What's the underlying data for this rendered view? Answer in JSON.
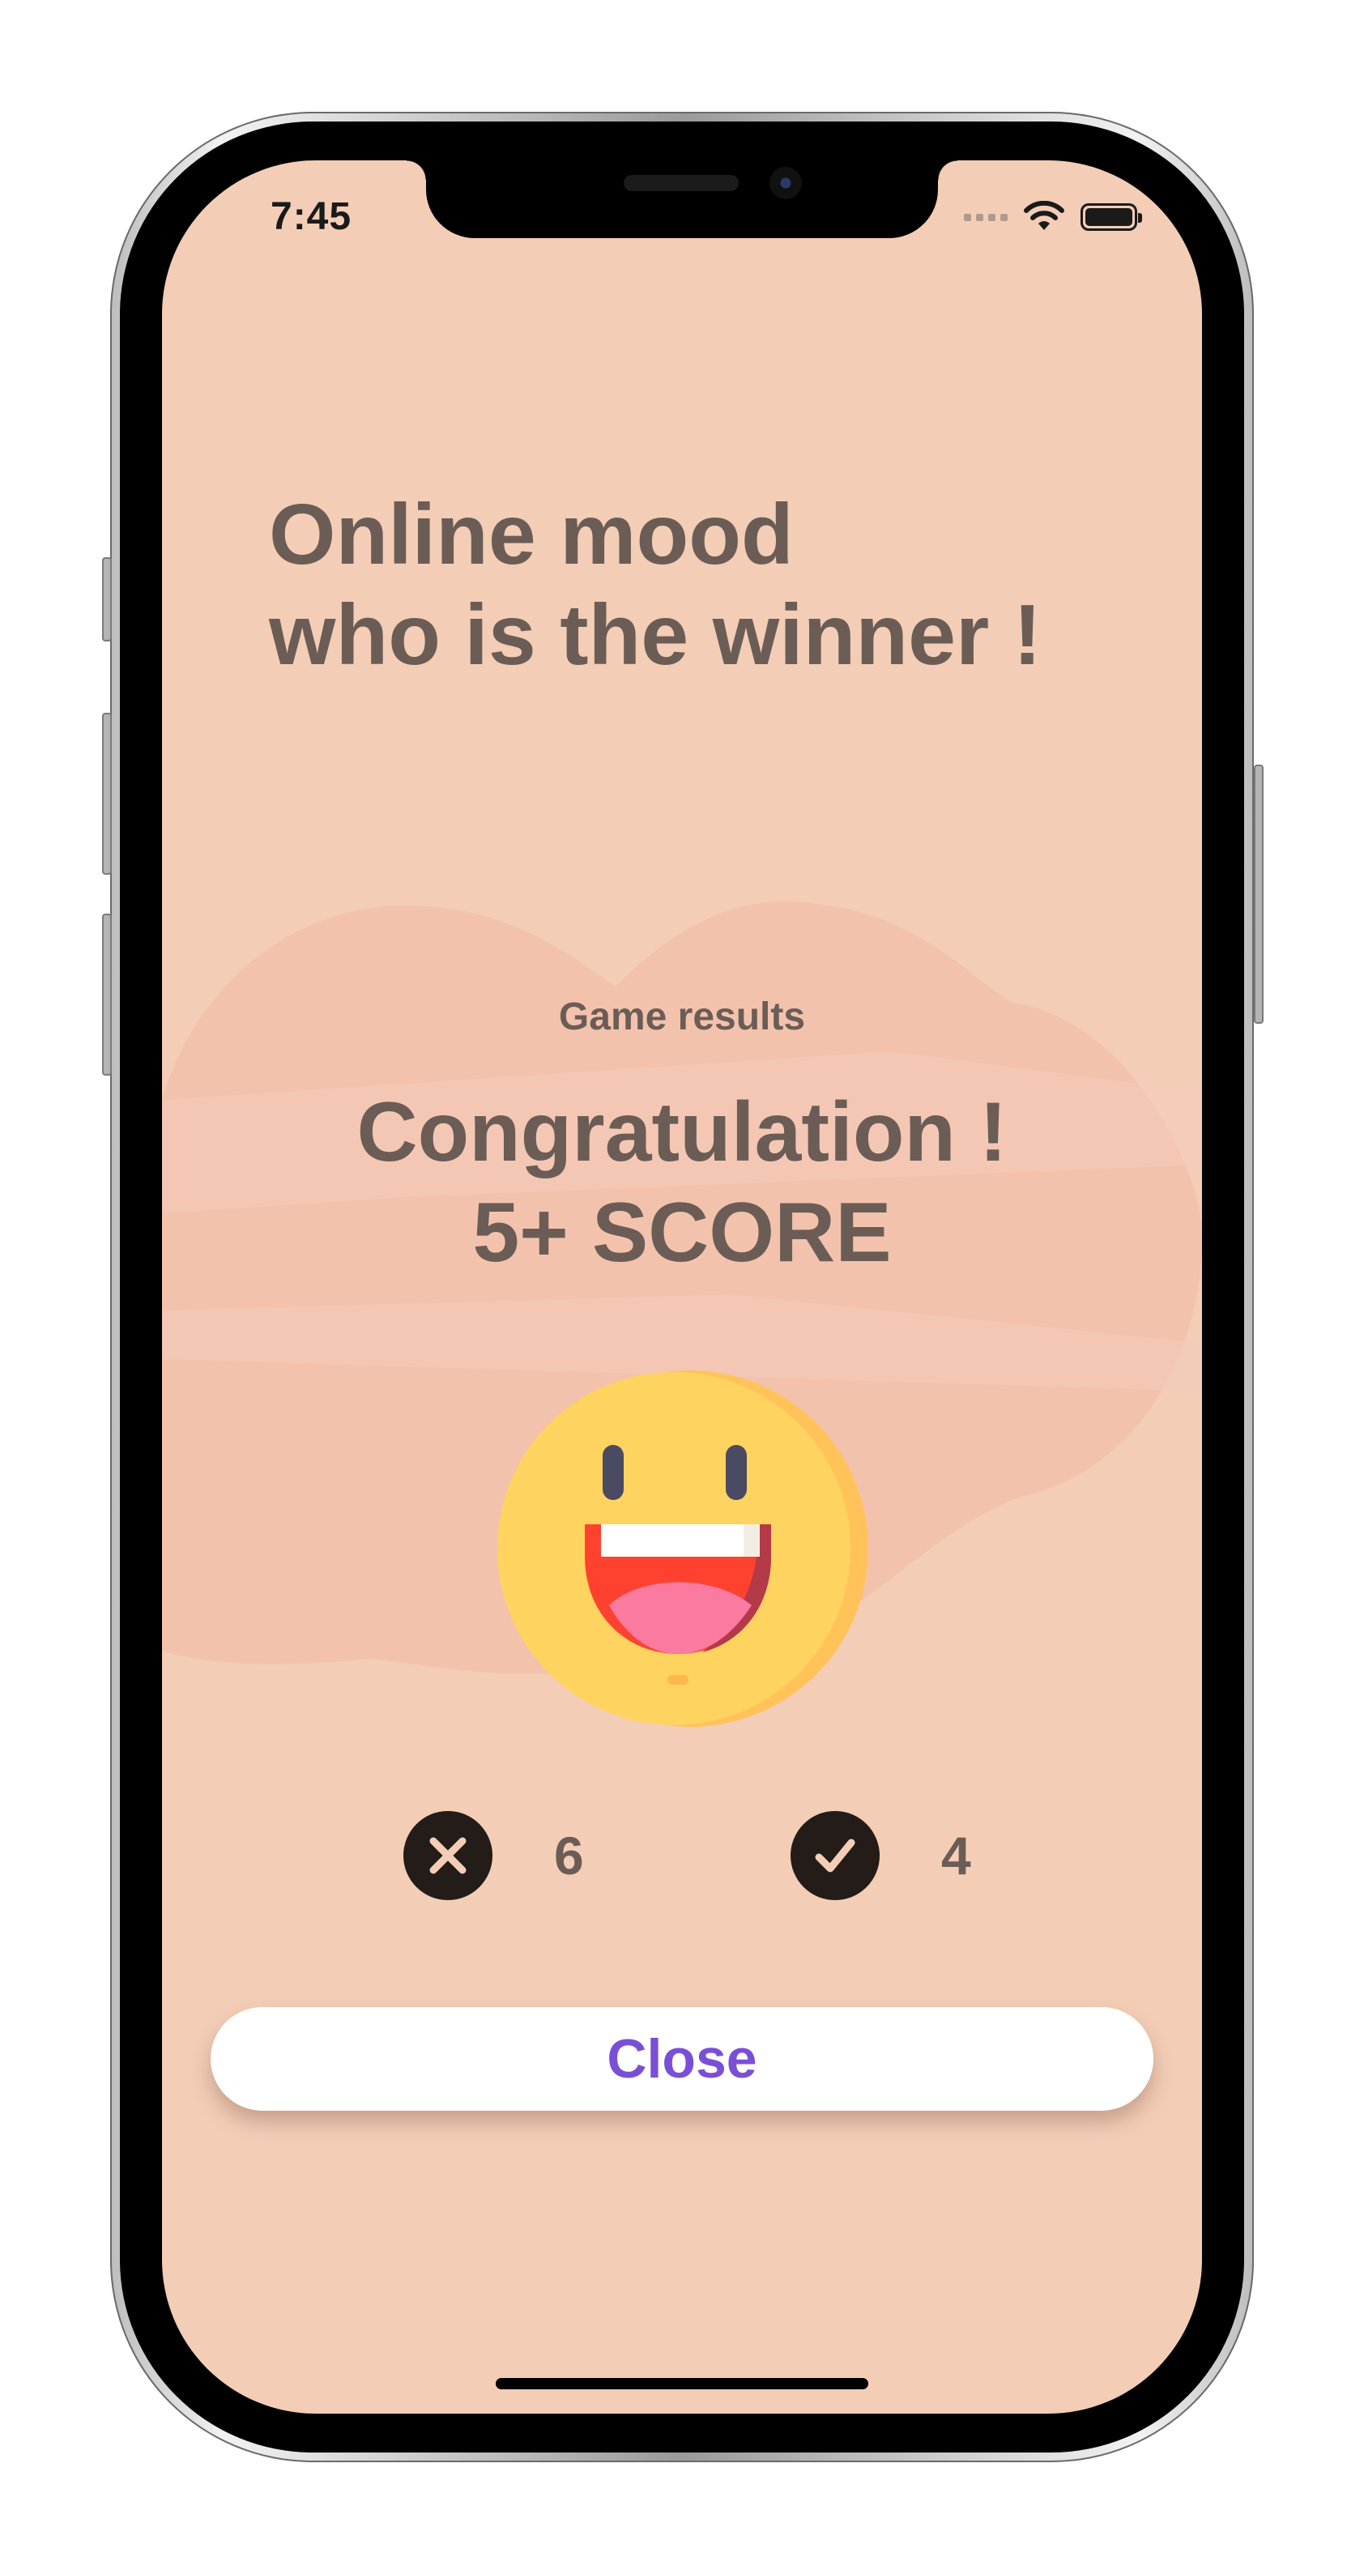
{
  "status_bar": {
    "time": "7:45",
    "icons": [
      "signal-dots-icon",
      "wifi-icon",
      "battery-icon"
    ]
  },
  "header": {
    "title_line1": "Online mood",
    "title_line2": "who is the winner !"
  },
  "results": {
    "label": "Game results",
    "headline_line1": "Congratulation !",
    "headline_line2": "5+ SCORE",
    "emoji": "laughing-face-icon",
    "wrong": {
      "icon": "cross-icon",
      "count": "6"
    },
    "correct": {
      "icon": "checkmark-icon",
      "count": "4"
    }
  },
  "actions": {
    "close_label": "Close"
  },
  "colors": {
    "background": "#f3cdb6",
    "text": "#6b5d55",
    "accent": "#7a4fd8",
    "icon_circle": "#231c19",
    "icon_glyph": "#f3cdb6"
  }
}
